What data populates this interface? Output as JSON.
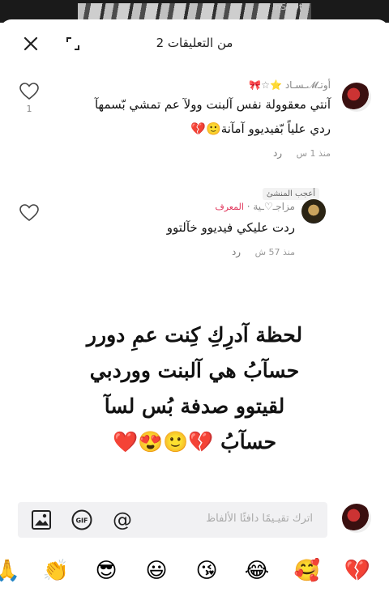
{
  "watermark": "InShOt",
  "header": {
    "title": "2 من التعليقات",
    "close_icon": "close-icon",
    "expand_icon": "expand-icon"
  },
  "comments": [
    {
      "username": "أوتـ𝓜ـسـاد ⭐☆🎀",
      "text_line1": "آنتي معقوولة نفس آلبنت وولآ عم تمشي بّسمهآ",
      "text_line2": "ردي علياً بّفيديوو آمآنة🙂💔",
      "time": "منذ 1 س",
      "reply_label": "رد",
      "liked_by": "أعجب المنشئ",
      "likes": "1"
    },
    {
      "username": "مزاجـ♡ـية",
      "author_badge": "المعرف",
      "text": "ردت عليكي فيديوو خآلتوو",
      "time": "منذ 57 ش",
      "reply_label": "رد"
    }
  ],
  "overlay_lines": [
    "لحظة آدرِكِ كِنت عمِ دورر",
    "حسآبُ هي آلبنت ووردبي",
    "لقيتوو صدفة بُس لسآ",
    "حسآبُ 💔🙂😍❤️"
  ],
  "input": {
    "placeholder": "اترك تقيـيمًا دافئًا الألفاظ",
    "icons": [
      "image-icon",
      "gif-icon",
      "mention-icon"
    ]
  },
  "emoji_bar": [
    "💔",
    "🥰",
    "😂",
    "😘",
    "😃",
    "😎",
    "👏",
    "🙏"
  ]
}
